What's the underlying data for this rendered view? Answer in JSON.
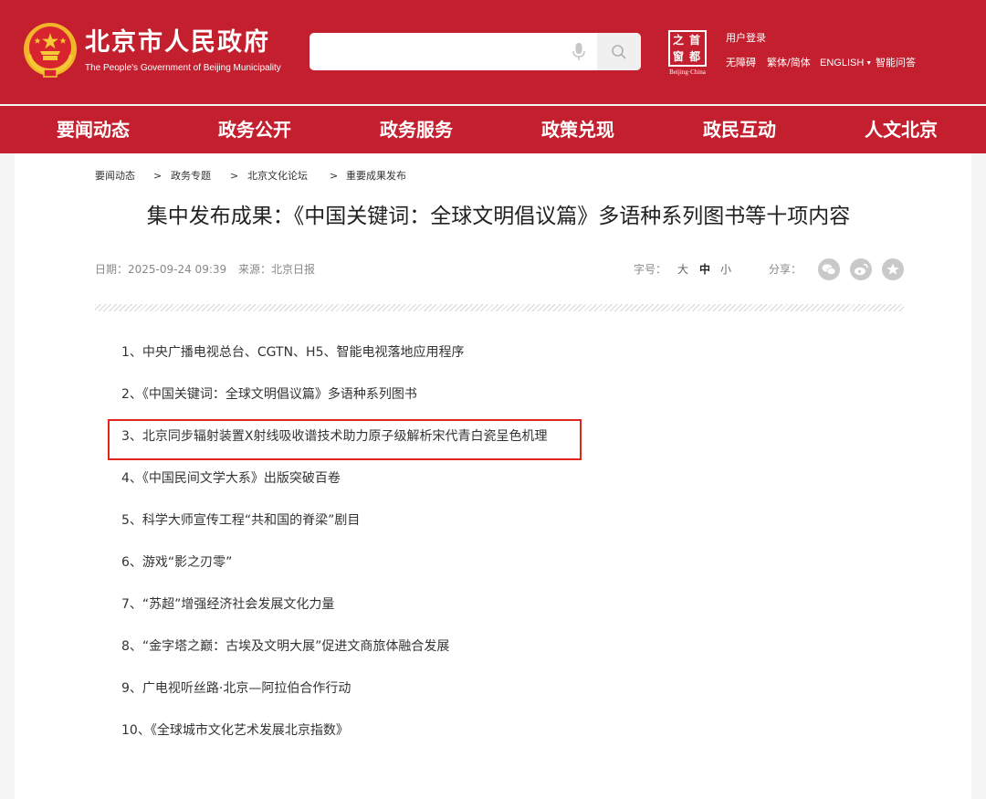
{
  "header": {
    "site_title": "北京市人民政府",
    "site_subtitle": "The People's Government of Beijing Municipality",
    "search": {
      "placeholder": "",
      "value": ""
    },
    "capital_logo": {
      "chars": [
        "之",
        "首",
        "窗",
        "都"
      ],
      "caption": "Beijing·China"
    },
    "user_login": "用户登录",
    "links": [
      "无障碍",
      "繁体/简体",
      "ENGLISH",
      "智能问答"
    ],
    "colors": {
      "brand_red": "#c41f2e"
    }
  },
  "nav": [
    "要闻动态",
    "政务公开",
    "政务服务",
    "政策兑现",
    "政民互动",
    "人文北京"
  ],
  "breadcrumb": {
    "items": [
      "要闻动态",
      "政务专题",
      "北京文化论坛",
      "重要成果发布"
    ],
    "separator": ">"
  },
  "article": {
    "title": "集中发布成果：《中国关键词：全球文明倡议篇》多语种系列图书等十项内容",
    "date": "日期：2025-09-24 09:39",
    "source": "来源：北京日报",
    "font_size_label": "字号：",
    "font_sizes": [
      "大",
      "中",
      "小"
    ],
    "active_font_size": "中",
    "share_label": "分享：",
    "share_icons": [
      "wechat-icon",
      "weibo-icon",
      "favorite-icon"
    ],
    "items": [
      "1、中央广播电视总台、CGTN、H5、智能电视落地应用程序",
      "2、《中国关键词：全球文明倡议篇》多语种系列图书",
      "3、北京同步辐射装置X射线吸收谱技术助力原子级解析宋代青白瓷呈色机理",
      "4、《中国民间文学大系》出版突破百卷",
      "5、科学大师宣传工程“共和国的脊梁”剧目",
      "6、游戏“影之刃零”",
      "7、“苏超”增强经济社会发展文化力量",
      "8、“金字塔之巅：古埃及文明大展”促进文商旅体融合发展",
      "9、广电视听丝路·北京—阿拉伯合作行动",
      "10、《全球城市文化艺术发展北京指数》"
    ],
    "highlighted_item_index": 2,
    "highlight_color": "#e0261c"
  }
}
